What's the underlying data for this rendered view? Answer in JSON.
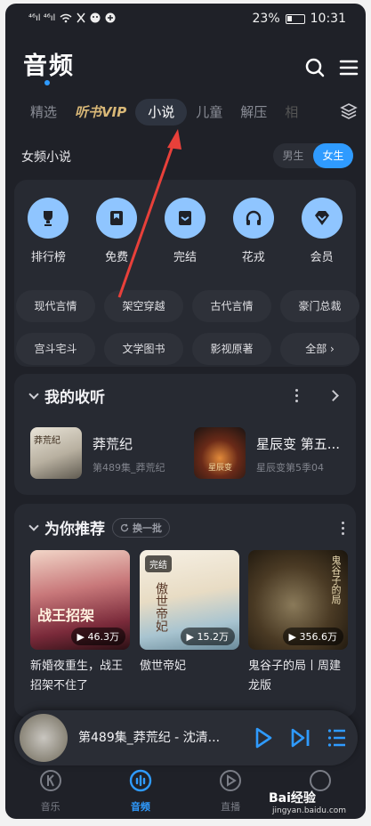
{
  "status_bar": {
    "signal_left": "⁴⁶ıl ⁴⁶ıl",
    "battery": "23%",
    "time": "10:31"
  },
  "header": {
    "title": "音频"
  },
  "tabs": [
    {
      "label": "精选"
    },
    {
      "label": "听书VIP"
    },
    {
      "label": "小说"
    },
    {
      "label": "儿童"
    },
    {
      "label": "解压"
    },
    {
      "label": "相"
    }
  ],
  "section": {
    "title": "女频小说",
    "gender_male": "男生",
    "gender_female": "女生"
  },
  "categories": [
    {
      "label": "排行榜",
      "icon": "trophy-icon"
    },
    {
      "label": "免费",
      "icon": "bookmark-icon"
    },
    {
      "label": "完结",
      "icon": "check-box-icon"
    },
    {
      "label": "花戎",
      "icon": "headphones-icon"
    },
    {
      "label": "会员",
      "icon": "diamond-icon"
    }
  ],
  "tags": [
    {
      "label": "现代言情"
    },
    {
      "label": "架空穿越"
    },
    {
      "label": "古代言情"
    },
    {
      "label": "豪门总裁"
    },
    {
      "label": "宫斗宅斗"
    },
    {
      "label": "文学图书"
    },
    {
      "label": "影视原著"
    },
    {
      "label": "全部 ›"
    }
  ],
  "my_listens": {
    "title": "我的收听",
    "items": [
      {
        "title": "莽荒纪",
        "sub": "第489集_莽荒纪",
        "cover_text": "莽荒纪"
      },
      {
        "title": "星辰变 第五...",
        "sub": "星辰变第5季04",
        "cover_text": "星辰变"
      }
    ]
  },
  "recommend": {
    "title": "为你推荐",
    "refresh_label": "换一批",
    "items": [
      {
        "title": "新婚夜重生，战王招架不住了",
        "plays": "46.3万",
        "badge": "",
        "cover_text": "战王招架"
      },
      {
        "title": "傲世帝妃",
        "plays": "15.2万",
        "badge": "完结",
        "cover_text": "傲世帝妃"
      },
      {
        "title": "鬼谷子的局丨周建龙版",
        "plays": "356.6万",
        "badge": "",
        "cover_text": "鬼谷子的局"
      }
    ]
  },
  "player": {
    "now_playing": "第489集_莽荒纪 - 沈清..."
  },
  "bottom_nav": [
    {
      "label": "音乐"
    },
    {
      "label": "音频"
    },
    {
      "label": "直播"
    },
    {
      "label": ""
    }
  ],
  "watermark": {
    "brand": "Bai经验",
    "url": "jingyan.baidu.com"
  },
  "colors": {
    "accent": "#2f9bff",
    "background": "#1f2128",
    "card": "#272a32",
    "annotation_arrow": "#e8403a"
  }
}
